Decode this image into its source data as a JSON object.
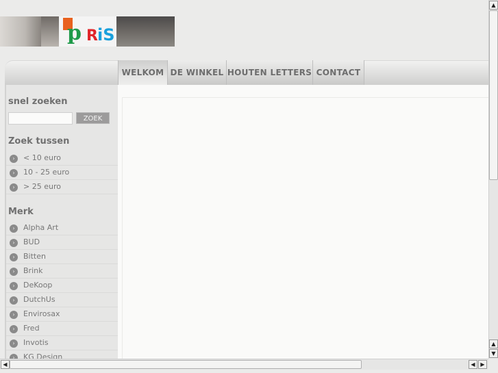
{
  "nav": {
    "tabs": [
      {
        "label": "WELKOM",
        "active": true
      },
      {
        "label": "DE WINKEL"
      },
      {
        "label": "HOUTEN LETTERS"
      },
      {
        "label": "CONTACT"
      }
    ]
  },
  "sidebar": {
    "search_title": "snel zoeken",
    "search_value": "",
    "search_button": "ZOEK",
    "price_title": "Zoek tussen",
    "prices": [
      "< 10 euro",
      "10 - 25 euro",
      "> 25 euro"
    ],
    "brand_title": "Merk",
    "brands": [
      "Alpha Art",
      "BUD",
      "Bitten",
      "Brink",
      "DeKoop",
      "DutchUs",
      "Envirosax",
      "Fred",
      "Invotis",
      "KG Design"
    ]
  },
  "scrollbars": {
    "vertical_position": 0,
    "horizontal_position": 0
  }
}
